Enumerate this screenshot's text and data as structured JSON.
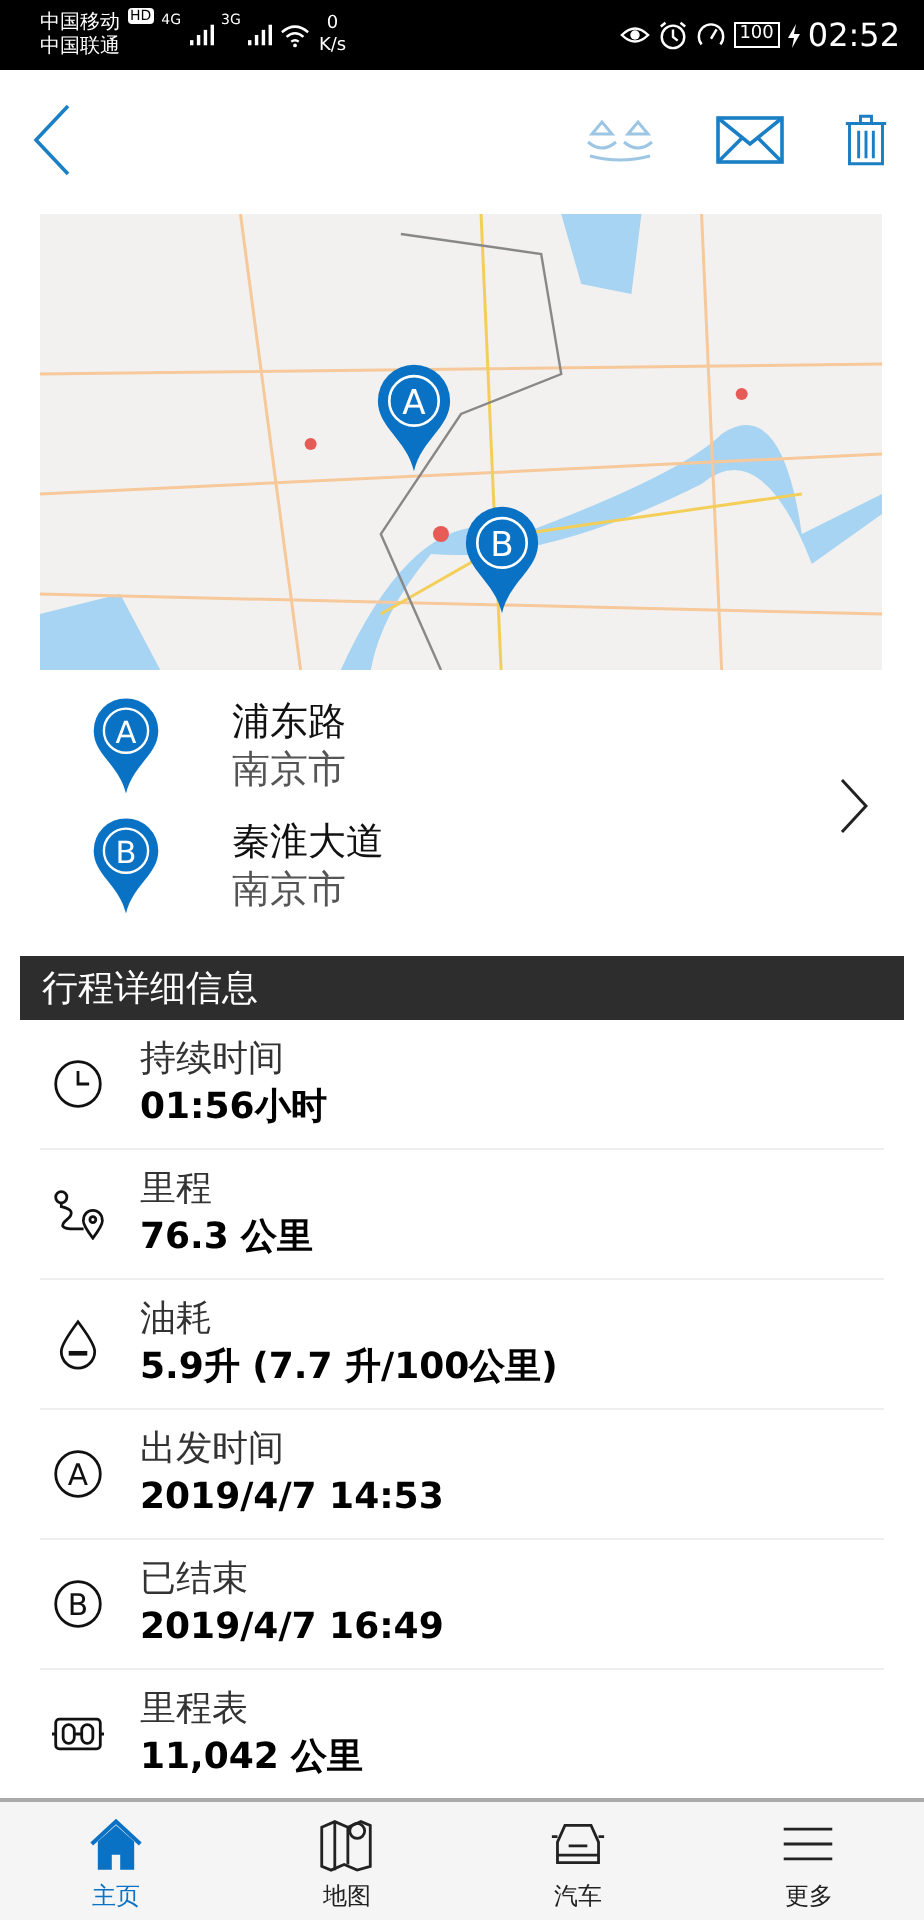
{
  "status_bar": {
    "carriers": [
      "中国移动",
      "中国联通"
    ],
    "hd_badge": "HD",
    "networks": [
      "4G",
      "3G"
    ],
    "speed_value": "0",
    "speed_unit": "K/s",
    "battery": "100",
    "time": "02:52"
  },
  "map": {
    "kind": "picture",
    "pins": [
      {
        "letter": "A"
      },
      {
        "letter": "B"
      }
    ]
  },
  "locations": [
    {
      "letter": "A",
      "street": "浦东路",
      "city": "南京市"
    },
    {
      "letter": "B",
      "street": "秦淮大道",
      "city": "南京市"
    }
  ],
  "section_title": "行程详细信息",
  "details": [
    {
      "kind": "clock",
      "label": "持续时间",
      "value": "01:56小时"
    },
    {
      "kind": "route",
      "label": "里程",
      "value": "76.3 公里"
    },
    {
      "kind": "drop",
      "label": "油耗",
      "value": "5.9升 (7.7 升/100公里)"
    },
    {
      "kind": "letter",
      "letter": "A",
      "label": "出发时间",
      "value": "2019/4/7 14:53"
    },
    {
      "kind": "letter",
      "letter": "B",
      "label": "已结束",
      "value": "2019/4/7 16:49"
    },
    {
      "kind": "odometer",
      "label": "里程表",
      "value": "11,042 公里"
    }
  ],
  "nav": [
    {
      "kind": "home",
      "label": "主页",
      "selected": true
    },
    {
      "kind": "map",
      "label": "地图",
      "selected": false
    },
    {
      "kind": "car",
      "label": "汽车",
      "selected": false
    },
    {
      "kind": "menu",
      "label": "更多",
      "selected": false
    }
  ]
}
